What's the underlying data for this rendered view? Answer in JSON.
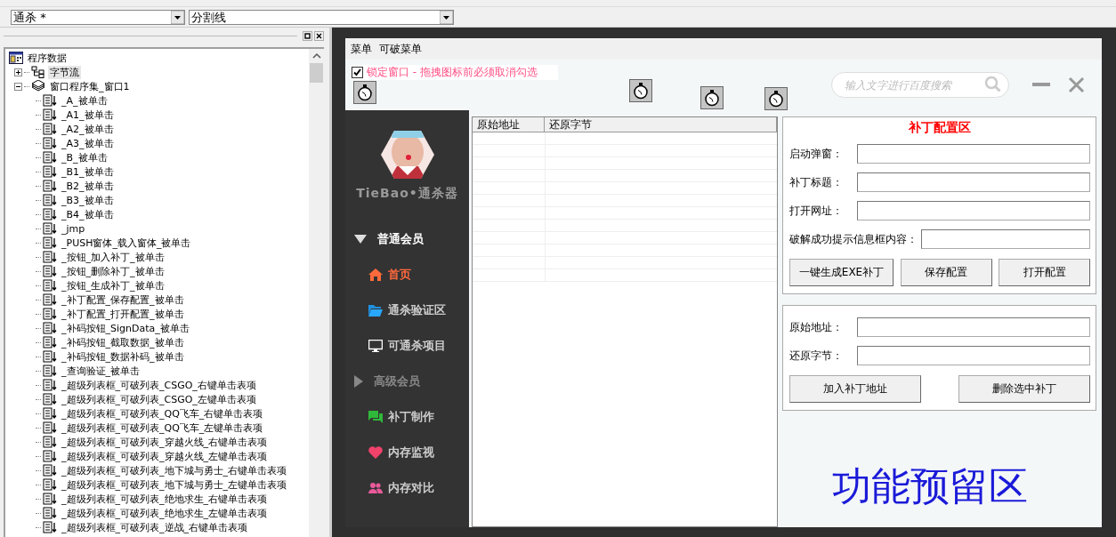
{
  "toolbar": {
    "combos": [
      {
        "value": "通杀 *"
      },
      {
        "value": "分割线"
      }
    ]
  },
  "tree": {
    "items": [
      {
        "label": "程序数据",
        "selected": false,
        "children": [
          {
            "label": "字节流",
            "expanded": false,
            "selected": true
          },
          {
            "label": "窗口程序集_窗口1",
            "expanded": true,
            "selected": false,
            "children": [
              {
                "label": "_A_被单击",
                "selected": false
              },
              {
                "label": "_A1_被单击",
                "selected": false
              },
              {
                "label": "_A2_被单击",
                "selected": false
              },
              {
                "label": "_A3_被单击",
                "selected": false
              },
              {
                "label": "_B_被单击",
                "selected": false
              },
              {
                "label": "_B1_被单击",
                "selected": false
              },
              {
                "label": "_B2_被单击",
                "selected": false
              },
              {
                "label": "_B3_被单击",
                "selected": false
              },
              {
                "label": "_B4_被单击",
                "selected": false
              },
              {
                "label": "_jmp",
                "selected": false
              },
              {
                "label": "_PUSH窗体_载入窗体_被单击",
                "selected": false
              },
              {
                "label": "_按钮_加入补丁_被单击",
                "selected": false
              },
              {
                "label": "_按钮_删除补丁_被单击",
                "selected": false
              },
              {
                "label": "_按钮_生成补丁_被单击",
                "selected": false
              },
              {
                "label": "_补丁配置_保存配置_被单击",
                "selected": false
              },
              {
                "label": "_补丁配置_打开配置_被单击",
                "selected": false
              },
              {
                "label": "_补码按钮_SignData_被单击",
                "selected": false
              },
              {
                "label": "_补码按钮_截取数据_被单击",
                "selected": false
              },
              {
                "label": "_补码按钮_数据补码_被单击",
                "selected": false
              },
              {
                "label": "_查询验证_被单击",
                "selected": false
              },
              {
                "label": "_超级列表框_可破列表_CSGO_右键单击表项",
                "selected": false
              },
              {
                "label": "_超级列表框_可破列表_CSGO_左键单击表项",
                "selected": false
              },
              {
                "label": "_超级列表框_可破列表_QQ飞车_右键单击表项",
                "selected": false
              },
              {
                "label": "_超级列表框_可破列表_QQ飞车_左键单击表项",
                "selected": false
              },
              {
                "label": "_超级列表框_可破列表_穿越火线_右键单击表项",
                "selected": false
              },
              {
                "label": "_超级列表框_可破列表_穿越火线_左键单击表项",
                "selected": false
              },
              {
                "label": "_超级列表框_可破列表_地下城与勇士_右键单击表项",
                "selected": false
              },
              {
                "label": "_超级列表框_可破列表_地下城与勇士_左键单击表项",
                "selected": false
              },
              {
                "label": "_超级列表框_可破列表_绝地求生_右键单击表项",
                "selected": false
              },
              {
                "label": "_超级列表框_可破列表_绝地求生_左键单击表项",
                "selected": false
              },
              {
                "label": "_超级列表框_可破列表_逆战_右键单击表项",
                "selected": false
              }
            ]
          }
        ]
      }
    ]
  },
  "form": {
    "menu": [
      "菜单",
      "可破菜单"
    ],
    "lock_checkbox": {
      "label": "锁定窗口 - 拖拽图标前必须取消勾选",
      "checked": true
    },
    "search": {
      "placeholder": "输入文字进行百度搜索"
    },
    "sidebar": {
      "title": "TieBao•通杀器",
      "items": [
        {
          "kind": "group",
          "label": "普通会员",
          "expanded": true
        },
        {
          "kind": "item",
          "label": "首页",
          "selected": true
        },
        {
          "kind": "item",
          "label": "通杀验证区",
          "selected": false
        },
        {
          "kind": "item",
          "label": "可通杀项目",
          "selected": false
        },
        {
          "kind": "group",
          "label": "高级会员",
          "expanded": false
        },
        {
          "kind": "item",
          "label": "补丁制作",
          "selected": false
        },
        {
          "kind": "item",
          "label": "内存监视",
          "selected": false
        },
        {
          "kind": "item",
          "label": "内存对比",
          "selected": false
        }
      ]
    }
  },
  "table": {
    "columns": [
      "原始地址",
      "还原字节"
    ]
  },
  "config_panel": {
    "title": "补丁配置区",
    "fields": [
      {
        "label": "启动弹窗："
      },
      {
        "label": "补丁标题："
      },
      {
        "label": "打开网址："
      },
      {
        "label": "破解成功提示信息框内容："
      }
    ],
    "buttons": [
      "一键生成EXE补丁",
      "保存配置",
      "打开配置"
    ]
  },
  "address_panel": {
    "fields": [
      {
        "label": "原始地址："
      },
      {
        "label": "还原字节："
      }
    ],
    "buttons": [
      "加入补丁地址",
      "删除选中补丁"
    ]
  },
  "reserved_area": {
    "label": "功能预留区"
  }
}
